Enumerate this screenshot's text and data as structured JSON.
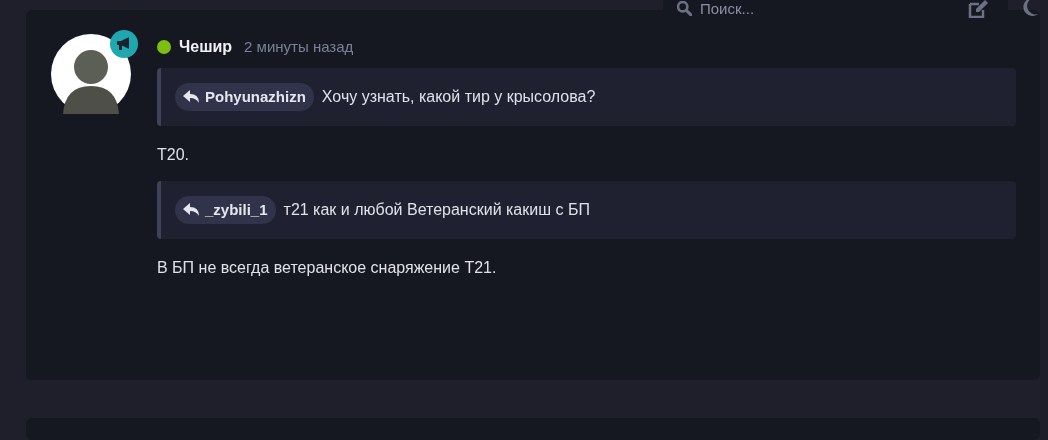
{
  "header": {
    "search": {
      "placeholder": "Поиск..."
    }
  },
  "post": {
    "author": {
      "name": "Чешир",
      "online": true
    },
    "time": "2 минуты назад",
    "body": [
      {
        "kind": "quote",
        "author": "Pohyunazhizn",
        "text": "Хочу узнать, какой тир у крысолова?"
      },
      {
        "kind": "text",
        "text": "Т20."
      },
      {
        "kind": "quote",
        "author": "_zybili_1",
        "text": "т21 как и любой Ветеранский какиш с БП"
      },
      {
        "kind": "text",
        "text": "В БП не всегда ветеранское снаряжение Т21."
      }
    ]
  }
}
